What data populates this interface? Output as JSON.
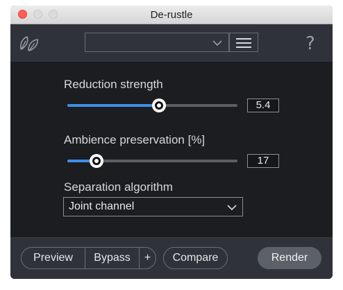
{
  "window": {
    "title": "De-rustle"
  },
  "toolbar": {
    "preset_value": "",
    "help_label": "?"
  },
  "controls": {
    "reduction_strength": {
      "label": "Reduction strength",
      "value": "5.4",
      "fraction": 0.54
    },
    "ambience_preservation": {
      "label": "Ambience preservation [%]",
      "value": "17",
      "fraction": 0.17
    },
    "separation_algorithm": {
      "label": "Separation algorithm",
      "selected": "Joint channel"
    }
  },
  "bottom": {
    "preview_label": "Preview",
    "bypass_label": "Bypass",
    "plus_label": "+",
    "compare_label": "Compare",
    "render_label": "Render"
  },
  "colors": {
    "accent": "#3f8ee8",
    "panel_bg": "#1b1d20",
    "bar_bg": "#2f3339"
  },
  "icons": [
    "leaf-icon",
    "chevron-down-icon",
    "hamburger-menu-icon",
    "help-icon"
  ]
}
